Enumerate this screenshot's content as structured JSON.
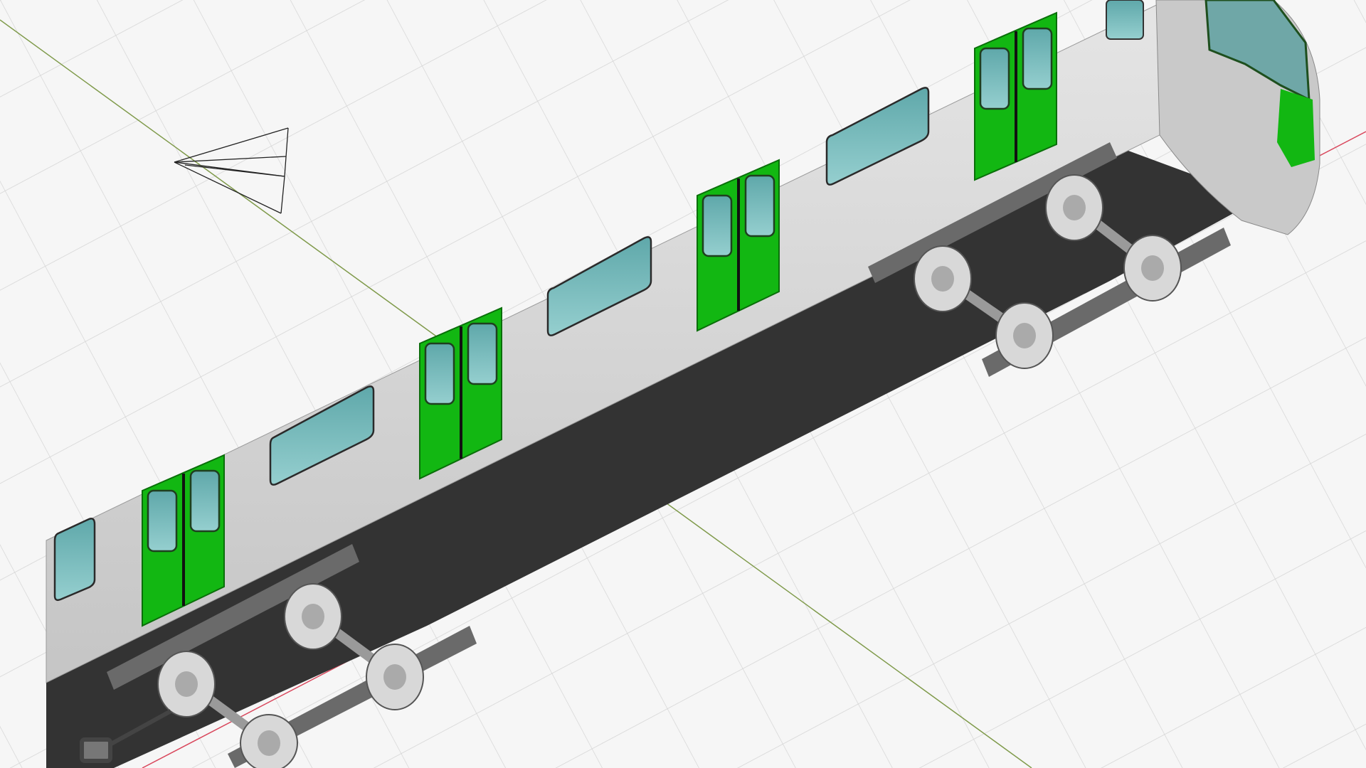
{
  "viewport": {
    "background": "#f6f6f6",
    "grid_color": "#d4d4d4",
    "axis_x_color": "#d9475c",
    "axis_y_color": "#7f9a4a"
  },
  "model": {
    "body_color": "#cfcfcf",
    "door_color": "#12b712",
    "window_color": "#79b8b8",
    "floor_color": "#333333",
    "bogie_color": "#8c8c8c",
    "wheel_color": "#d8d8d8"
  },
  "camera_gizmo": {
    "icon": "camera-frustum-icon"
  }
}
